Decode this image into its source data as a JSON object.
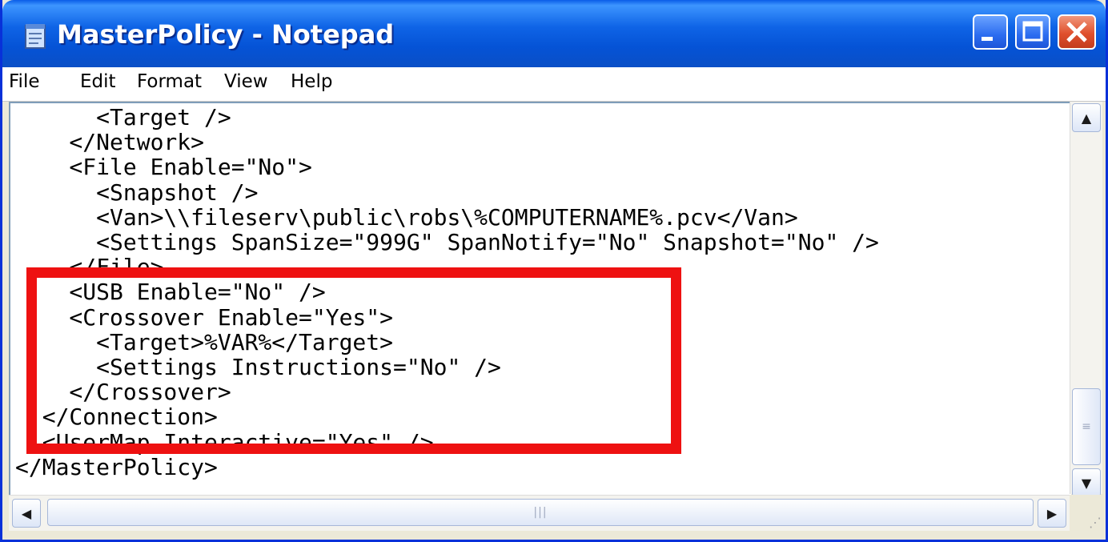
{
  "window": {
    "title": "MasterPolicy - Notepad",
    "titlebar_color": "#0553d6",
    "close_color": "#e0502d"
  },
  "menu": [
    {
      "label": "File"
    },
    {
      "label": "Edit"
    },
    {
      "label": "Format"
    },
    {
      "label": "View"
    },
    {
      "label": "Help"
    }
  ],
  "editor": {
    "lines": [
      "      <Target />",
      "    </Network>",
      "    <File Enable=\"No\">",
      "      <Snapshot />",
      "      <Van>\\\\fileserv\\public\\robs\\%COMPUTERNAME%.pcv</Van>",
      "      <Settings SpanSize=\"999G\" SpanNotify=\"No\" Snapshot=\"No\" />",
      "    </File>",
      "    <USB Enable=\"No\" />",
      "    <Crossover Enable=\"Yes\">",
      "      <Target>%VAR%</Target>",
      "      <Settings Instructions=\"No\" />",
      "    </Crossover>",
      "  </Connection>",
      "  <UserMap Interactive=\"Yes\" />",
      "</MasterPolicy>"
    ],
    "highlight_color": "#ee1111"
  },
  "scroll": {
    "up_icon": "▲",
    "down_icon": "▼",
    "left_icon": "◀",
    "right_icon": "▶",
    "grip_icon": "≡",
    "hgrip_icon": "|||",
    "resize_icon": "⋰"
  }
}
